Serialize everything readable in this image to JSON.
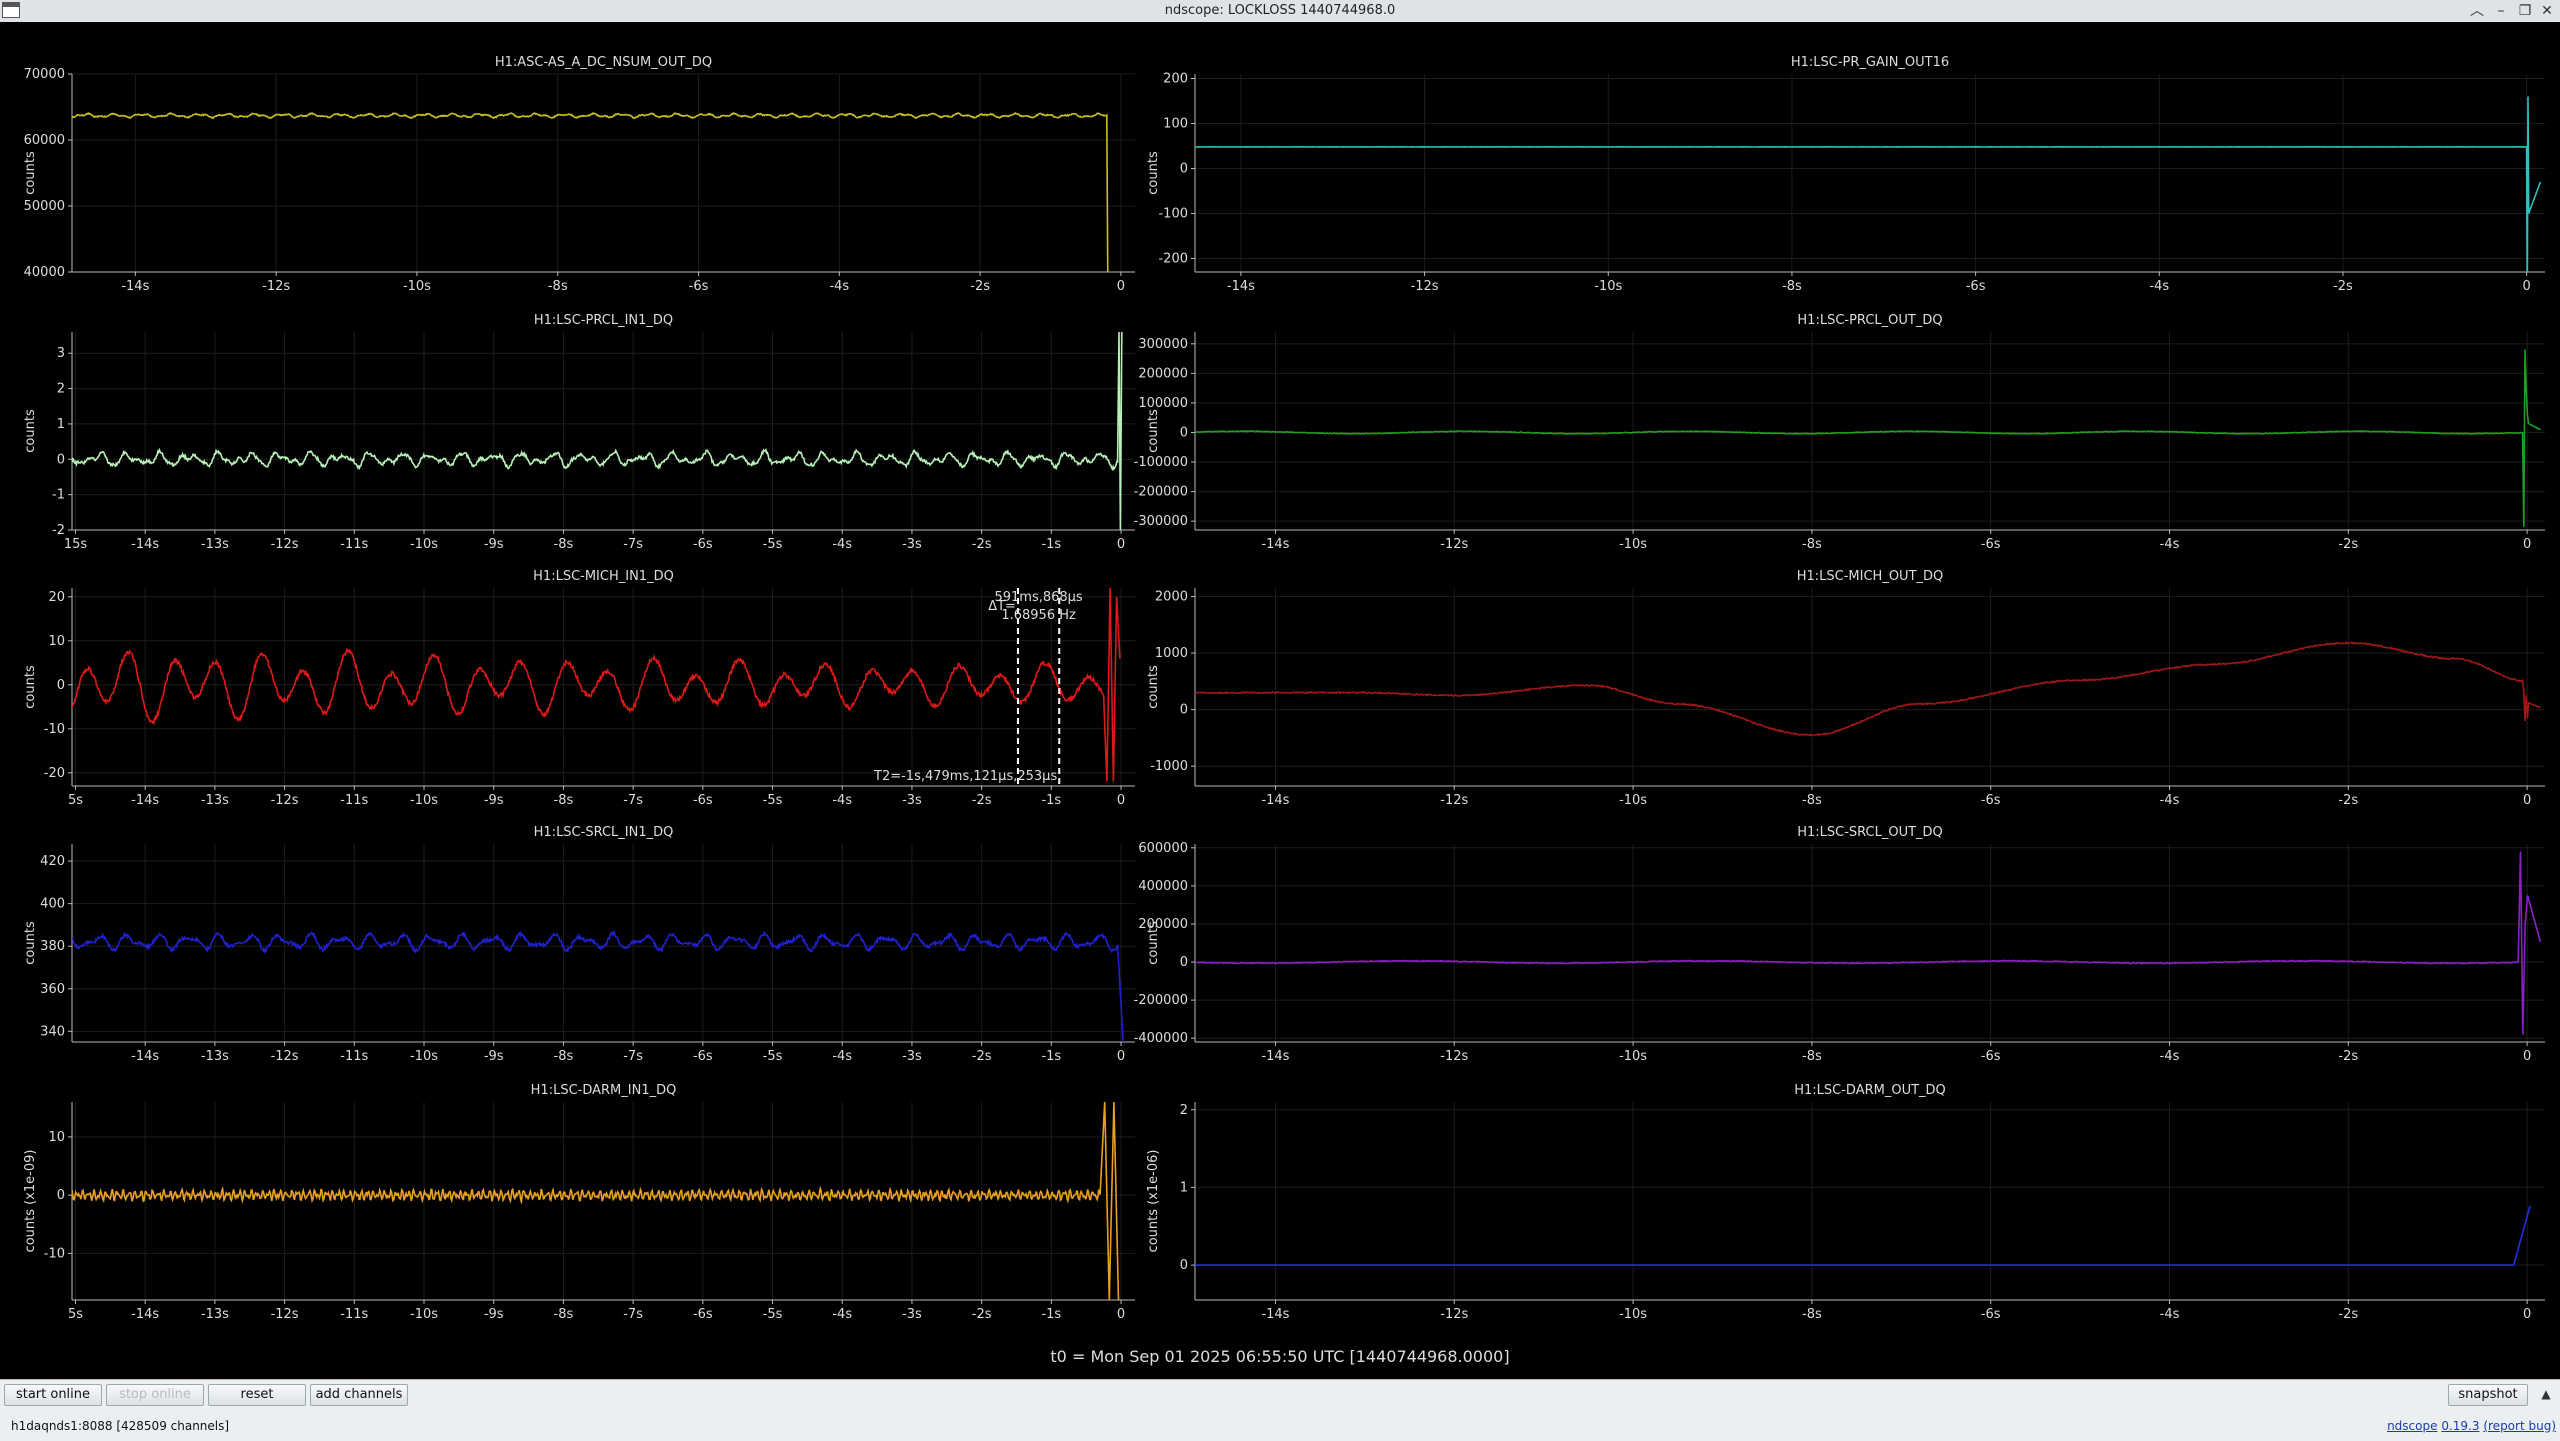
{
  "window": {
    "title": "ndscope: LOCKLOSS 1440744968.0"
  },
  "time_label": "t0 = Mon Sep 01 2025 06:55:50 UTC [1440744968.0000]",
  "toolbar": {
    "start_online": "start online",
    "stop_online": "stop online",
    "reset": "reset",
    "add_channels": "add channels",
    "snapshot": "snapshot"
  },
  "status": {
    "server": "h1daqnds1:8088  [428509 channels]",
    "app_name": "ndscope",
    "version": "0.19.3",
    "report_bug": "(report bug)"
  },
  "cursor": {
    "delta_t": "ΔT=",
    "delta_value": "591ms,868μs",
    "delta_freq": "1.68956 Hz",
    "t2": "T2=-1s,479ms,121μs,253μs"
  },
  "colors": {
    "background": "#000000",
    "grid": "#1d1d1d",
    "axis": "#bbbbbb",
    "text": "#dddddd"
  },
  "chart_data": [
    {
      "type": "line",
      "title": "H1:ASC-AS_A_DC_NSUM_OUT_DQ",
      "ylabel": "counts",
      "color": "#c8c020",
      "xlim": [
        -14.9,
        0.2
      ],
      "ylim": [
        40000,
        70000
      ],
      "xticks": [
        -14,
        -12,
        -10,
        -8,
        -6,
        -4,
        -2,
        0
      ],
      "xtick_labels": [
        "-14s",
        "-12s",
        "-10s",
        "-8s",
        "-6s",
        "-4s",
        "-2s",
        "0"
      ],
      "yticks": [
        40000,
        50000,
        60000,
        70000
      ],
      "ytick_labels": [
        "40000",
        "50000",
        "60000",
        "70000"
      ],
      "signal": {
        "base": 63700,
        "noise": 80,
        "waves": [
          [
            200,
            2.5
          ],
          [
            120,
            6
          ]
        ],
        "spike": {
          "start": -0.2,
          "type": "spike",
          "amps": [
            -3500,
            6000,
            -9000,
            10000,
            -10000
          ]
        }
      }
    },
    {
      "type": "line",
      "title": "H1:LSC-PR_GAIN_OUT16",
      "ylabel": "counts",
      "color": "#30c0c0",
      "xlim": [
        -14.5,
        0.2
      ],
      "ylim": [
        -230,
        210
      ],
      "xticks": [
        -14,
        -12,
        -10,
        -8,
        -6,
        -4,
        -2,
        0
      ],
      "xtick_labels": [
        "-14s",
        "-12s",
        "-10s",
        "-8s",
        "-6s",
        "-4s",
        "-2s",
        "0"
      ],
      "yticks": [
        -200,
        -100,
        0,
        100,
        200
      ],
      "ytick_labels": [
        "-200",
        "-100",
        "0",
        "100",
        "200"
      ],
      "signal": {
        "base": 48,
        "noise": 0.3,
        "waves": [],
        "spike": {
          "start": 0,
          "type": "osc",
          "amps": [
            -280,
            160,
            -100
          ]
        }
      }
    },
    {
      "type": "line",
      "title": "H1:LSC-PRCL_IN1_DQ",
      "ylabel": "counts",
      "color": "#b8f0b8",
      "xlim": [
        -15.05,
        0.2
      ],
      "ylim": [
        -2,
        3.6
      ],
      "xticks": [
        -15,
        -14,
        -13,
        -12,
        -11,
        -10,
        -9,
        -8,
        -7,
        -6,
        -5,
        -4,
        -3,
        -2,
        -1,
        0
      ],
      "xtick_labels": [
        "15s",
        "-14s",
        "-13s",
        "-12s",
        "-11s",
        "-10s",
        "-9s",
        "-8s",
        "-7s",
        "-6s",
        "-5s",
        "-4s",
        "-3s",
        "-2s",
        "-1s",
        "0"
      ],
      "yticks": [
        -2,
        -1,
        0,
        1,
        2,
        3
      ],
      "ytick_labels": [
        "-2",
        "-1",
        "0",
        "1",
        "2",
        "3"
      ],
      "signal": {
        "base": 0,
        "noise": 0.04,
        "waves": [
          [
            0.12,
            2.3
          ],
          [
            0.08,
            3.7
          ],
          [
            0.05,
            6.1
          ]
        ],
        "spike": {
          "start": -0.05,
          "type": "spike",
          "amps": [
            3.6,
            -2,
            3.6
          ]
        }
      }
    },
    {
      "type": "line",
      "title": "H1:LSC-PRCL_OUT_DQ",
      "ylabel": "counts",
      "color": "#20a020",
      "xlim": [
        -14.9,
        0.2
      ],
      "ylim": [
        -330000,
        340000
      ],
      "xticks": [
        -14,
        -12,
        -10,
        -8,
        -6,
        -4,
        -2,
        0
      ],
      "xtick_labels": [
        "-14s",
        "-12s",
        "-10s",
        "-8s",
        "-6s",
        "-4s",
        "-2s",
        "0"
      ],
      "yticks": [
        -300000,
        -200000,
        -100000,
        0,
        100000,
        200000,
        300000
      ],
      "ytick_labels": [
        "-300000",
        "-200000",
        "-100000",
        "0",
        "100000",
        "200000",
        "300000"
      ],
      "signal": {
        "base": 0,
        "noise": 1200,
        "waves": [
          [
            4000,
            0.4
          ]
        ],
        "spike": {
          "start": -0.05,
          "type": "osc",
          "amps": [
            -320000,
            280000,
            150000,
            60000,
            30000
          ]
        }
      }
    },
    {
      "type": "line",
      "title": "H1:LSC-MICH_IN1_DQ",
      "ylabel": "counts",
      "color": "#e01818",
      "xlim": [
        -15.05,
        0.2
      ],
      "ylim": [
        -23,
        22
      ],
      "xticks": [
        -15,
        -14,
        -13,
        -12,
        -11,
        -10,
        -9,
        -8,
        -7,
        -6,
        -5,
        -4,
        -3,
        -2,
        -1,
        0
      ],
      "xtick_labels": [
        "5s",
        "-14s",
        "-13s",
        "-12s",
        "-11s",
        "-10s",
        "-9s",
        "-8s",
        "-7s",
        "-6s",
        "-5s",
        "-4s",
        "-3s",
        "-2s",
        "-1s",
        "0"
      ],
      "yticks": [
        -20,
        -10,
        0,
        10,
        20
      ],
      "ytick_labels": [
        "-20",
        "-10",
        "0",
        "10",
        "20"
      ],
      "cursors": [
        -1.479,
        -0.887
      ],
      "signal": {
        "base": 0,
        "noise": 0.5,
        "waves": [
          [
            6,
            1.6
          ],
          [
            3,
            0.9
          ]
        ],
        "growth": [
          -15,
          9,
          -3,
          5
        ],
        "spike": {
          "start": -0.25,
          "type": "spike",
          "amps": [
            -22,
            22,
            -22,
            20,
            6
          ]
        }
      }
    },
    {
      "type": "line",
      "title": "H1:LSC-MICH_OUT_DQ",
      "ylabel": "counts",
      "color": "#a01818",
      "xlim": [
        -14.9,
        0.2
      ],
      "ylim": [
        -1350,
        2150
      ],
      "xticks": [
        -14,
        -12,
        -10,
        -8,
        -6,
        -4,
        -2,
        0
      ],
      "xtick_labels": [
        "-14s",
        "-12s",
        "-10s",
        "-8s",
        "-6s",
        "-4s",
        "-2s",
        "0"
      ],
      "yticks": [
        -1000,
        0,
        1000,
        2000
      ],
      "ytick_labels": [
        "-1000",
        "0",
        "1000",
        "2000"
      ],
      "knots": [
        [
          -14.9,
          300
        ],
        [
          -13,
          300
        ],
        [
          -12,
          250
        ],
        [
          -10.5,
          430
        ],
        [
          -9.5,
          100
        ],
        [
          -8,
          -450
        ],
        [
          -6.8,
          100
        ],
        [
          -5,
          520
        ],
        [
          -3.5,
          800
        ],
        [
          -2,
          1180
        ],
        [
          -0.8,
          900
        ],
        [
          0,
          500
        ]
      ],
      "signal": {
        "base": 0,
        "noise": 12,
        "waves": [],
        "spike": {
          "start": -0.05,
          "type": "osc",
          "amps": [
            300,
            -200,
            250,
            -150,
            120
          ]
        }
      }
    },
    {
      "type": "line",
      "title": "H1:LSC-SRCL_IN1_DQ",
      "ylabel": "counts",
      "color": "#2020d0",
      "xlim": [
        -15.05,
        0.2
      ],
      "ylim": [
        335,
        428
      ],
      "xticks": [
        -14,
        -13,
        -12,
        -11,
        -10,
        -9,
        -8,
        -7,
        -6,
        -5,
        -4,
        -3,
        -2,
        -1,
        0
      ],
      "xtick_labels": [
        "-14s",
        "-13s",
        "-12s",
        "-11s",
        "-10s",
        "-9s",
        "-8s",
        "-7s",
        "-6s",
        "-5s",
        "-4s",
        "-3s",
        "-2s",
        "-1s",
        "0"
      ],
      "yticks": [
        340,
        360,
        380,
        400,
        420
      ],
      "ytick_labels": [
        "340",
        "360",
        "380",
        "400",
        "420"
      ],
      "signal": {
        "base": 382,
        "noise": 0.8,
        "waves": [
          [
            2.5,
            2.3
          ],
          [
            1.5,
            3.7
          ]
        ],
        "spike": {
          "start": -0.05,
          "type": "drop",
          "amps": [
            335
          ]
        }
      }
    },
    {
      "type": "line",
      "title": "H1:LSC-SRCL_OUT_DQ",
      "ylabel": "counts",
      "color": "#8a20c8",
      "xlim": [
        -14.9,
        0.2
      ],
      "ylim": [
        -420000,
        620000
      ],
      "xticks": [
        -14,
        -12,
        -10,
        -8,
        -6,
        -4,
        -2,
        0
      ],
      "xtick_labels": [
        "-14s",
        "-12s",
        "-10s",
        "-8s",
        "-6s",
        "-4s",
        "-2s",
        "0"
      ],
      "yticks": [
        -400000,
        -200000,
        0,
        200000,
        400000,
        600000
      ],
      "ytick_labels": [
        "-400000",
        "-200000",
        "0",
        "200000",
        "400000",
        "600000"
      ],
      "signal": {
        "base": 0,
        "noise": 2500,
        "waves": [
          [
            6000,
            0.3
          ]
        ],
        "spike": {
          "start": -0.1,
          "type": "osc",
          "amps": [
            580000,
            -380000,
            200000,
            350000
          ]
        }
      }
    },
    {
      "type": "line",
      "title": "H1:LSC-DARM_IN1_DQ",
      "ylabel": "counts (x1e-09)",
      "color": "#e8a020",
      "xlim": [
        -15.05,
        0.2
      ],
      "ylim": [
        -18,
        16
      ],
      "xticks": [
        -15,
        -14,
        -13,
        -12,
        -11,
        -10,
        -9,
        -8,
        -7,
        -6,
        -5,
        -4,
        -3,
        -2,
        -1,
        0
      ],
      "xtick_labels": [
        "5s",
        "-14s",
        "-13s",
        "-12s",
        "-11s",
        "-10s",
        "-9s",
        "-8s",
        "-7s",
        "-6s",
        "-5s",
        "-4s",
        "-3s",
        "-2s",
        "-1s",
        "0"
      ],
      "yticks": [
        -10,
        0,
        10
      ],
      "ytick_labels": [
        "-10",
        "0",
        "10"
      ],
      "signal": {
        "base": 0,
        "noise": 0.25,
        "waves": [
          [
            0.5,
            12
          ],
          [
            0.4,
            19
          ]
        ],
        "spike": {
          "start": -0.3,
          "type": "spike",
          "amps": [
            16,
            -18,
            16,
            -18
          ]
        }
      }
    },
    {
      "type": "line",
      "title": "H1:LSC-DARM_OUT_DQ",
      "ylabel": "counts (x1e-06)",
      "color": "#2030e0",
      "xlim": [
        -14.9,
        0.2
      ],
      "ylim": [
        -0.45,
        2.1
      ],
      "xticks": [
        -14,
        -12,
        -10,
        -8,
        -6,
        -4,
        -2,
        0
      ],
      "xtick_labels": [
        "-14s",
        "-12s",
        "-10s",
        "-8s",
        "-6s",
        "-4s",
        "-2s",
        "0"
      ],
      "yticks": [
        0,
        1,
        2
      ],
      "ytick_labels": [
        "0",
        "1",
        "2"
      ],
      "signal": {
        "base": 0,
        "noise": 0,
        "waves": [],
        "spike": {
          "start": -0.15,
          "type": "ramp",
          "amps": [
            0.75
          ]
        }
      }
    }
  ]
}
